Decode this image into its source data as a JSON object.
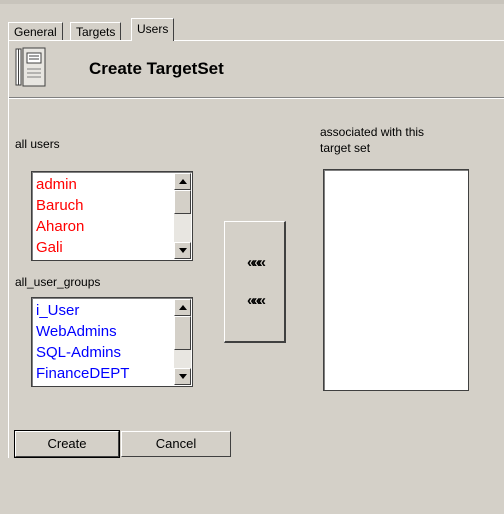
{
  "tabs": [
    {
      "label": "General"
    },
    {
      "label": "Targets"
    },
    {
      "label": "Users"
    }
  ],
  "active_tab": "Users",
  "header": {
    "icon": "book-icon",
    "title": "Create TargetSet"
  },
  "all_users": {
    "label": "all users",
    "items": [
      "admin",
      "Baruch",
      "Aharon",
      "Gali"
    ],
    "item_color": "#ff0000"
  },
  "all_user_groups": {
    "label": "all_user_groups",
    "items": [
      "i_User",
      "WebAdmins",
      "SQL-Admins",
      "FinanceDEPT"
    ],
    "item_color": "#0000ff"
  },
  "move_buttons": {
    "users_to_target": "«««",
    "groups_to_target": "«««"
  },
  "associated": {
    "label_line1": "associated with this",
    "label_line2": "target set",
    "items": []
  },
  "footer": {
    "create_label": "Create",
    "cancel_label": "Cancel"
  }
}
